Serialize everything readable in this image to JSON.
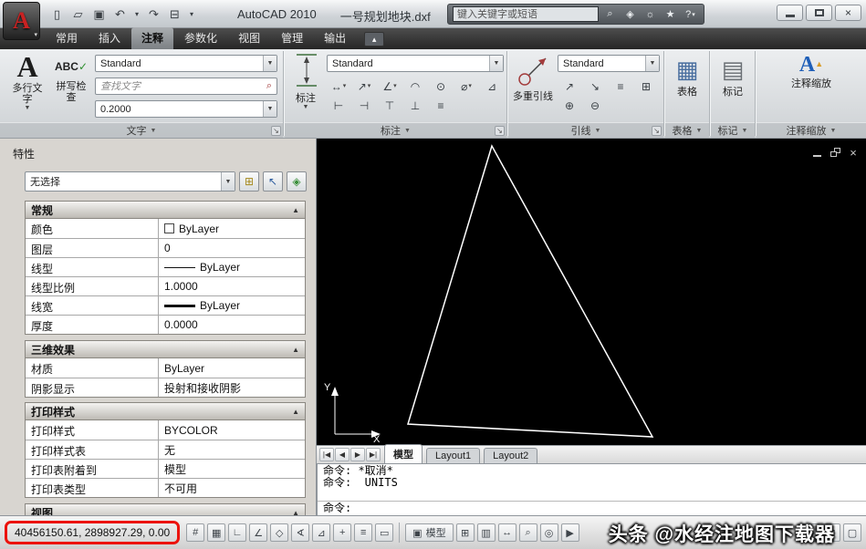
{
  "window": {
    "app_title": "AutoCAD 2010",
    "doc_title": "一号规划地块.dxf",
    "search_placeholder": "键入关键字或短语"
  },
  "ribbon": {
    "tabs": [
      {
        "label": "常用"
      },
      {
        "label": "插入"
      },
      {
        "label": "注释"
      },
      {
        "label": "参数化"
      },
      {
        "label": "视图"
      },
      {
        "label": "管理"
      },
      {
        "label": "输出"
      }
    ],
    "text_panel": {
      "title": "文字",
      "mtext_label": "多行文字",
      "abc": "ABC",
      "spell_label": "拼写检查",
      "style": "Standard",
      "find_placeholder": "查找文字",
      "height": "0.2000"
    },
    "dim_panel": {
      "title": "标注",
      "button_label": "标注",
      "style": "Standard"
    },
    "leader_panel": {
      "title": "引线",
      "button_label": "多重引线",
      "style": "Standard"
    },
    "table_panel": {
      "title": "表格",
      "button_label": "表格"
    },
    "markup_panel": {
      "title": "标记",
      "button_label": "标记"
    },
    "annoscale_panel": {
      "title": "注释缩放",
      "button_label": "注释缩放"
    }
  },
  "properties": {
    "title": "特性",
    "selection": "无选择",
    "sections": [
      {
        "title": "常规",
        "rows": [
          {
            "label": "颜色",
            "value": "ByLayer"
          },
          {
            "label": "图层",
            "value": "0"
          },
          {
            "label": "线型",
            "value": "ByLayer"
          },
          {
            "label": "线型比例",
            "value": "1.0000"
          },
          {
            "label": "线宽",
            "value": "ByLayer"
          },
          {
            "label": "厚度",
            "value": "0.0000"
          }
        ]
      },
      {
        "title": "三维效果",
        "rows": [
          {
            "label": "材质",
            "value": "ByLayer"
          },
          {
            "label": "阴影显示",
            "value": "投射和接收阴影"
          }
        ]
      },
      {
        "title": "打印样式",
        "rows": [
          {
            "label": "打印样式",
            "value": "BYCOLOR"
          },
          {
            "label": "打印样式表",
            "value": "无"
          },
          {
            "label": "打印表附着到",
            "value": "模型"
          },
          {
            "label": "打印表类型",
            "value": "不可用"
          }
        ]
      },
      {
        "title": "视图",
        "rows": []
      }
    ]
  },
  "drawing": {
    "ucs_x": "X",
    "ucs_y": "Y"
  },
  "layout_tabs": {
    "tabs": [
      {
        "label": "模型"
      },
      {
        "label": "Layout1"
      },
      {
        "label": "Layout2"
      }
    ]
  },
  "command": {
    "lines": [
      "命令: *取消*",
      "命令:  UNITS",
      ""
    ],
    "prompt": "命令:"
  },
  "status": {
    "coordinates": "40456150.61, 2898927.29, 0.00",
    "model_label": "模型"
  },
  "watermark": "头条 @水经注地图下载器",
  "icons": {
    "logo": "A",
    "new": "▯",
    "open": "▱",
    "save": "▣",
    "undo": "↶",
    "redo": "↷",
    "plot": "⊟",
    "caret": "▾",
    "find": "⌕",
    "subscription": "◈",
    "communication": "☼",
    "favorites": "★",
    "help": "?",
    "ribbon_state": "▴",
    "combo": "▼",
    "launcher": "↘",
    "collapse": "▲",
    "close": "×",
    "dim_row1": [
      "↔",
      "↗",
      "∠",
      "◠",
      "⊙",
      "⌀",
      "⊿"
    ],
    "dim_row2": [
      "⊢",
      "⊣",
      "⊤",
      "⊥",
      "≡"
    ],
    "leader_row1": [
      "↗",
      "↘",
      "≡",
      "⊞"
    ],
    "leader_row2": [
      "⊕",
      "⊖"
    ],
    "table": "▦",
    "markup": "▤",
    "annoscale_a": "A",
    "annoscale_tri": "▲",
    "nav": [
      "|◀",
      "◀",
      "▶",
      "▶|"
    ],
    "toggles": [
      "#",
      "▦",
      "∟",
      "∠",
      "◇",
      "∢",
      "⊿",
      "+",
      "≡",
      "▭"
    ],
    "model": "▣",
    "qv_layouts": "⊞",
    "qv_drawings": "▥",
    "pan": "↔",
    "zoom": "⌕",
    "wheel": "◎",
    "motion": "▶",
    "workspace": "⊛",
    "lock": "⊠",
    "clean": "▢",
    "pickadd": "⊞",
    "select_objects": "↖",
    "quick_select": "◈"
  }
}
